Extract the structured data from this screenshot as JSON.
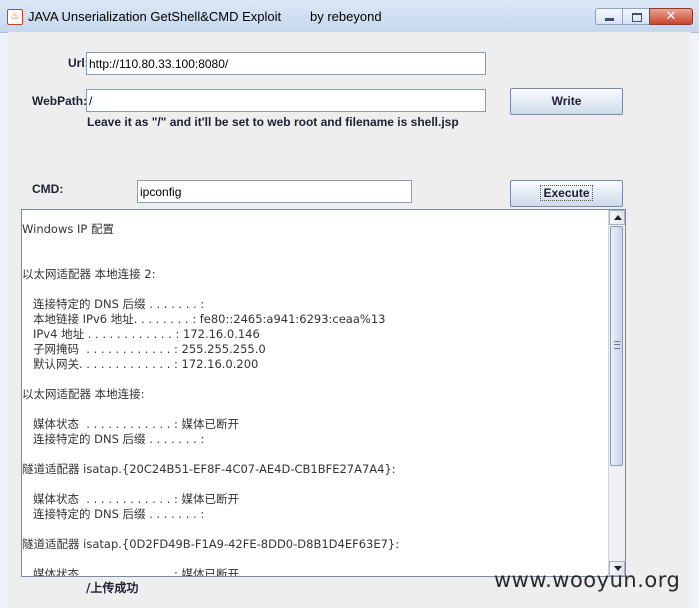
{
  "window": {
    "title": "JAVA Unserialization GetShell&CMD Exploit        by rebeyond",
    "icon": "java-cup-icon",
    "controls": [
      "minimize-icon",
      "maximize-icon",
      "close-icon"
    ],
    "close_glyph": "✕"
  },
  "form": {
    "url_label": "Url:",
    "url_value": "http://110.80.33.100:8080/",
    "webpath_label": "WebPath:",
    "webpath_value": "/",
    "write_button": "Write",
    "hint": "Leave it as \"/\" and it'll be set to web root and filename is shell.jsp",
    "cmd_label": "CMD:",
    "cmd_value": "ipconfig",
    "execute_button": "Execute"
  },
  "output": {
    "text": "Windows IP 配置\n\n\n以太网适配器 本地连接 2:\n\n   连接特定的 DNS 后缀 . . . . . . . :\n   本地链接 IPv6 地址. . . . . . . . : fe80::2465:a941:6293:ceaa%13\n   IPv4 地址 . . . . . . . . . . . . : 172.16.0.146\n   子网掩码  . . . . . . . . . . . . : 255.255.255.0\n   默认网关. . . . . . . . . . . . . : 172.16.0.200\n\n以太网适配器 本地连接:\n\n   媒体状态  . . . . . . . . . . . . : 媒体已断开\n   连接特定的 DNS 后缀 . . . . . . . :\n\n隧道适配器 isatap.{20C24B51-EF8F-4C07-AE4D-CB1BFE27A7A4}:\n\n   媒体状态  . . . . . . . . . . . . : 媒体已断开\n   连接特定的 DNS 后缀 . . . . . . . :\n\n隧道适配器 isatap.{0D2FD49B-F1A9-42FE-8DD0-D8B1D4EF63E7}:\n\n   媒体状态  . . . . . . . . . . . . : 媒体已断开"
  },
  "status": {
    "text": "/上传成功"
  },
  "watermark": {
    "text": "www.wooyun.org"
  }
}
